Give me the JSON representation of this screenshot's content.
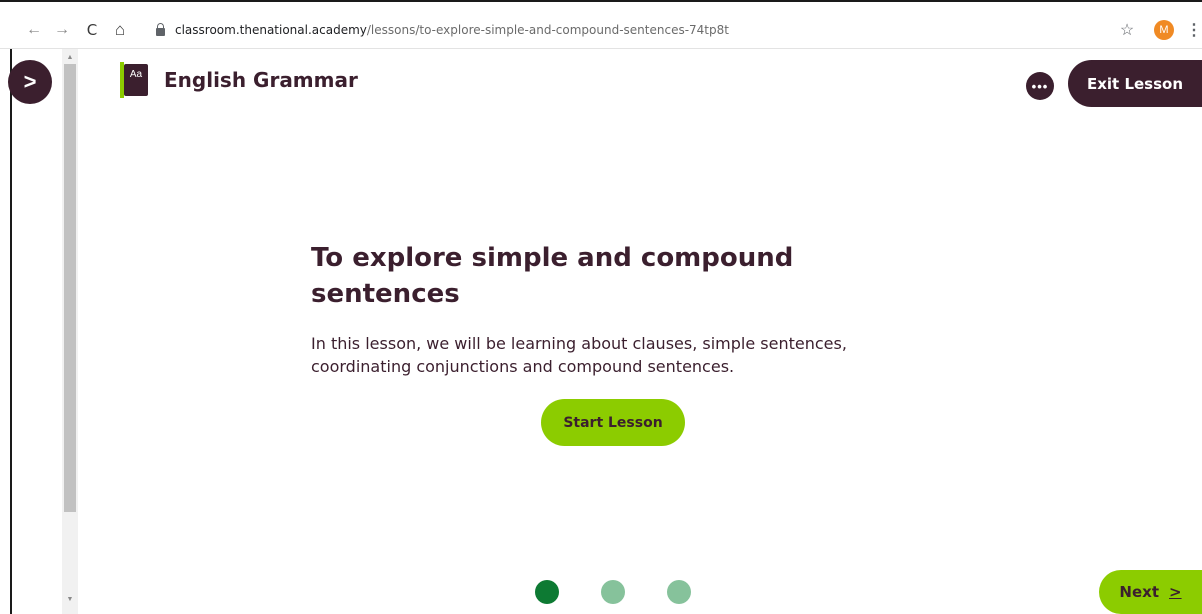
{
  "browser": {
    "url_domain": "classroom.thenational.academy",
    "url_path": "/lessons/to-explore-simple-and-compound-sentences-74tp8t",
    "profile_initial": "M",
    "back_glyph": "←",
    "forward_glyph": "→",
    "reload_glyph": "C",
    "home_glyph": "⌂",
    "star_glyph": "☆",
    "menu_glyph": "⋮"
  },
  "header": {
    "subject_title": "English Grammar",
    "subject_icon_text": "Aa",
    "exit_label": "Exit Lesson",
    "more_glyph": "•••",
    "sidebar_glyph": ">"
  },
  "lesson": {
    "title": "To explore simple and compound sentences",
    "description": "In this lesson, we will be learning about clauses, simple sentences, coordinating conjunctions and compound sentences.",
    "start_label": "Start Lesson"
  },
  "footer": {
    "next_label": "Next",
    "next_glyph": ">",
    "progress_current": 1,
    "progress_total": 3
  },
  "colors": {
    "brand_dark": "#3b1f2e",
    "brand_green": "#8ccc00",
    "dot_active": "#0d7a33",
    "dot_inactive": "#86c29b",
    "profile_orange": "#f08a24"
  }
}
